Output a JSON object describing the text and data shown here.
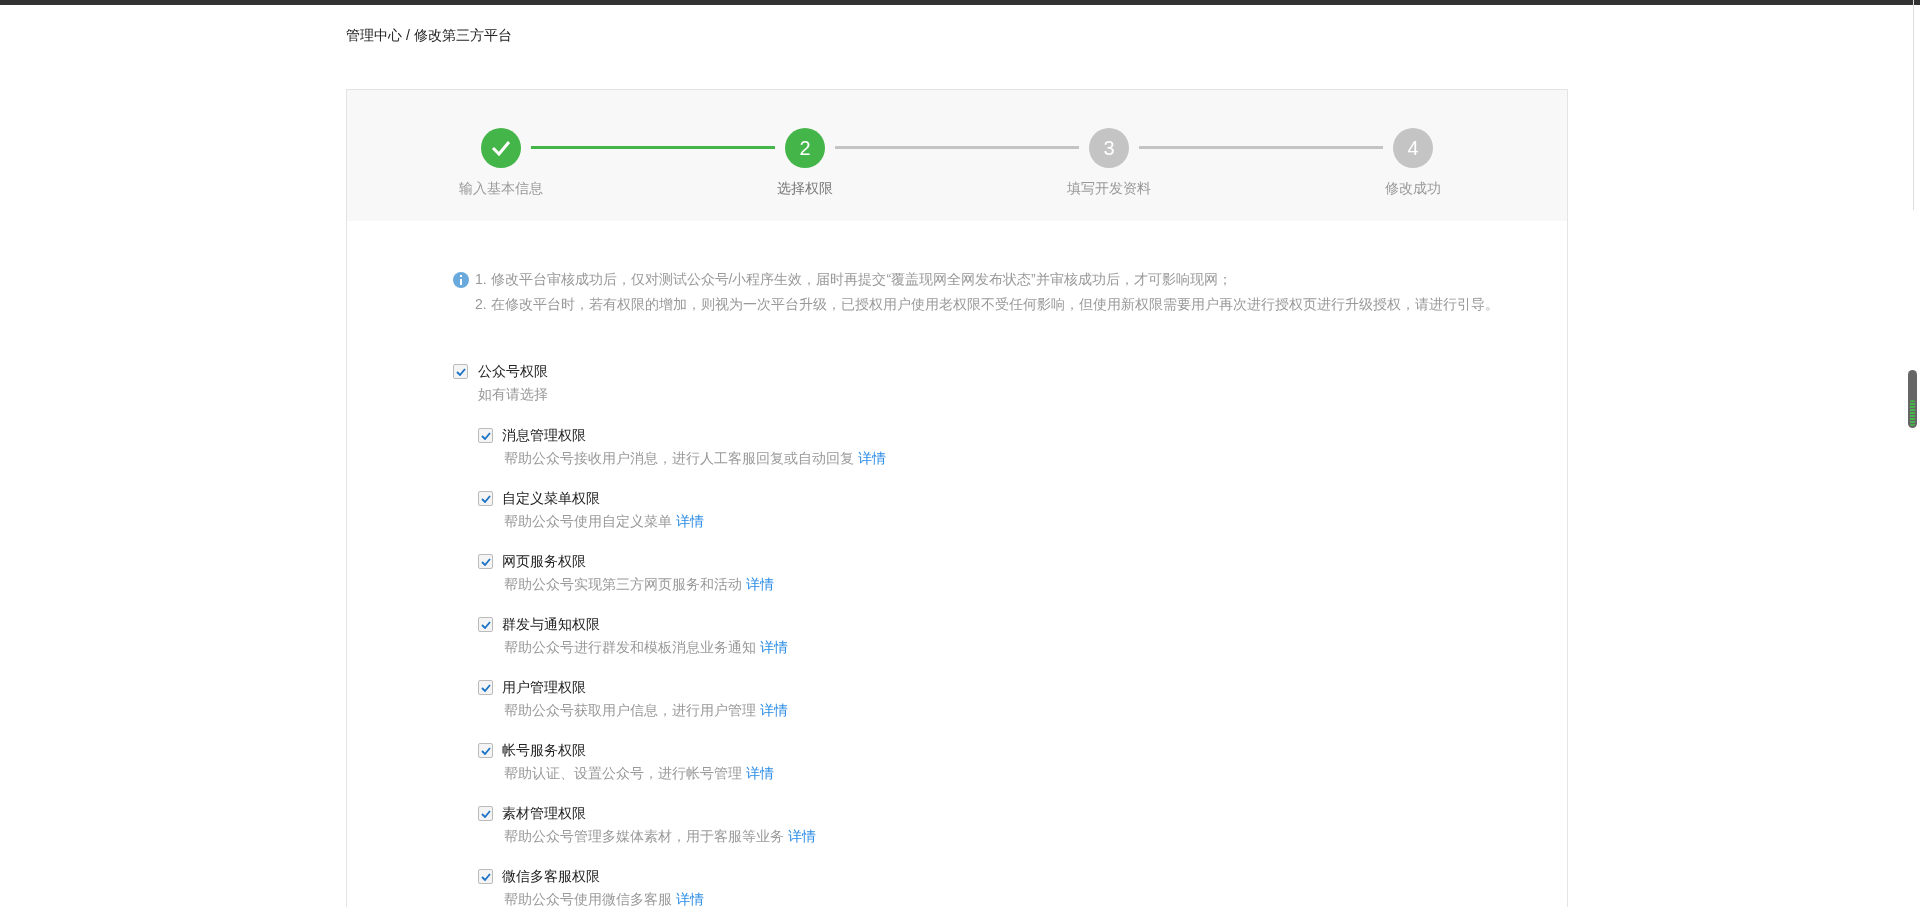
{
  "breadcrumb": {
    "parent": "管理中心",
    "separator": "/",
    "current": "修改第三方平台"
  },
  "steps": [
    {
      "label": "输入基本信息",
      "completed": true,
      "selected": false
    },
    {
      "number": "2",
      "label": "选择权限",
      "completed": false,
      "selected": true
    },
    {
      "number": "3",
      "label": "填写开发资料",
      "completed": false,
      "selected": false
    },
    {
      "number": "4",
      "label": "修改成功",
      "completed": false,
      "selected": false
    }
  ],
  "notice": [
    "1. 修改平台审核成功后，仅对测试公众号/小程序生效，届时再提交“覆盖现网全网发布状态”并审核成功后，才可影响现网；",
    "2. 在修改平台时，若有权限的增加，则视为一次平台升级，已授权用户使用老权限不受任何影响，但使用新权限需要用户再次进行授权页进行升级授权，请进行引导。"
  ],
  "group": {
    "label": "公众号权限",
    "checked": true,
    "hint": "如有请选择",
    "items": [
      {
        "label": "消息管理权限",
        "checked": true,
        "description": "帮助公众号接收用户消息，进行人工客服回复或自动回复",
        "link": "详情"
      },
      {
        "label": "自定义菜单权限",
        "checked": true,
        "description": "帮助公众号使用自定义菜单",
        "link": "详情"
      },
      {
        "label": "网页服务权限",
        "checked": true,
        "description": "帮助公众号实现第三方网页服务和活动",
        "link": "详情"
      },
      {
        "label": "群发与通知权限",
        "checked": true,
        "description": "帮助公众号进行群发和模板消息业务通知",
        "link": "详情"
      },
      {
        "label": "用户管理权限",
        "checked": true,
        "description": "帮助公众号获取用户信息，进行用户管理",
        "link": "详情"
      },
      {
        "label": "帐号服务权限",
        "checked": true,
        "description": "帮助认证、设置公众号，进行帐号管理",
        "link": "详情"
      },
      {
        "label": "素材管理权限",
        "checked": true,
        "description": "帮助公众号管理多媒体素材，用于客服等业务",
        "link": "详情"
      },
      {
        "label": "微信多客服权限",
        "checked": true,
        "description": "帮助公众号使用微信多客服",
        "link": "详情"
      }
    ]
  }
}
